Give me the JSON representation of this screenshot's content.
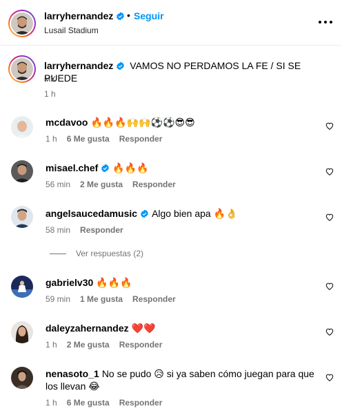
{
  "header": {
    "username": "larryhernandez",
    "separator": "•",
    "follow_label": "Seguir",
    "location": "Lusail Stadium",
    "more_icon": "more-horizontal-icon"
  },
  "caption": {
    "username": "larryhernandez",
    "text": "VAMOS NO PERDAMOS LA FE / SI SE PUEDE",
    "suffix": "MX",
    "time": "1 h"
  },
  "comments": [
    {
      "username": "mcdavoo",
      "text": "🔥🔥🔥🙌🙌⚽⚽😎😎",
      "time": "1 h",
      "likes": "6 Me gusta",
      "reply": "Responder",
      "verified": false
    },
    {
      "username": "misael.chef",
      "text": "🔥🔥🔥",
      "time": "56 min",
      "likes": "2 Me gusta",
      "reply": "Responder",
      "verified": true
    },
    {
      "username": "angelsaucedamusic",
      "text": "Algo bien apa 🔥👌",
      "time": "58 min",
      "likes": "",
      "reply": "Responder",
      "verified": true
    },
    {
      "username": "gabrielv30",
      "text": "🔥🔥🔥",
      "time": "59 min",
      "likes": "1 Me gusta",
      "reply": "Responder",
      "verified": false
    },
    {
      "username": "daleyzahernandez",
      "text": "❤️❤️",
      "time": "1 h",
      "likes": "2 Me gusta",
      "reply": "Responder",
      "verified": false
    },
    {
      "username": "nenasoto_1",
      "text": "No se pudo 😥 si ya saben cómo juegan para que los llevan 😂",
      "time": "1 h",
      "likes": "6 Me gusta",
      "reply": "Responder",
      "verified": false
    }
  ],
  "view_replies": "Ver respuestas (2)",
  "colors": {
    "link": "#0095f6",
    "verified": "#0095f6",
    "heart_red": "#ed1c24",
    "meta": "#737373"
  }
}
